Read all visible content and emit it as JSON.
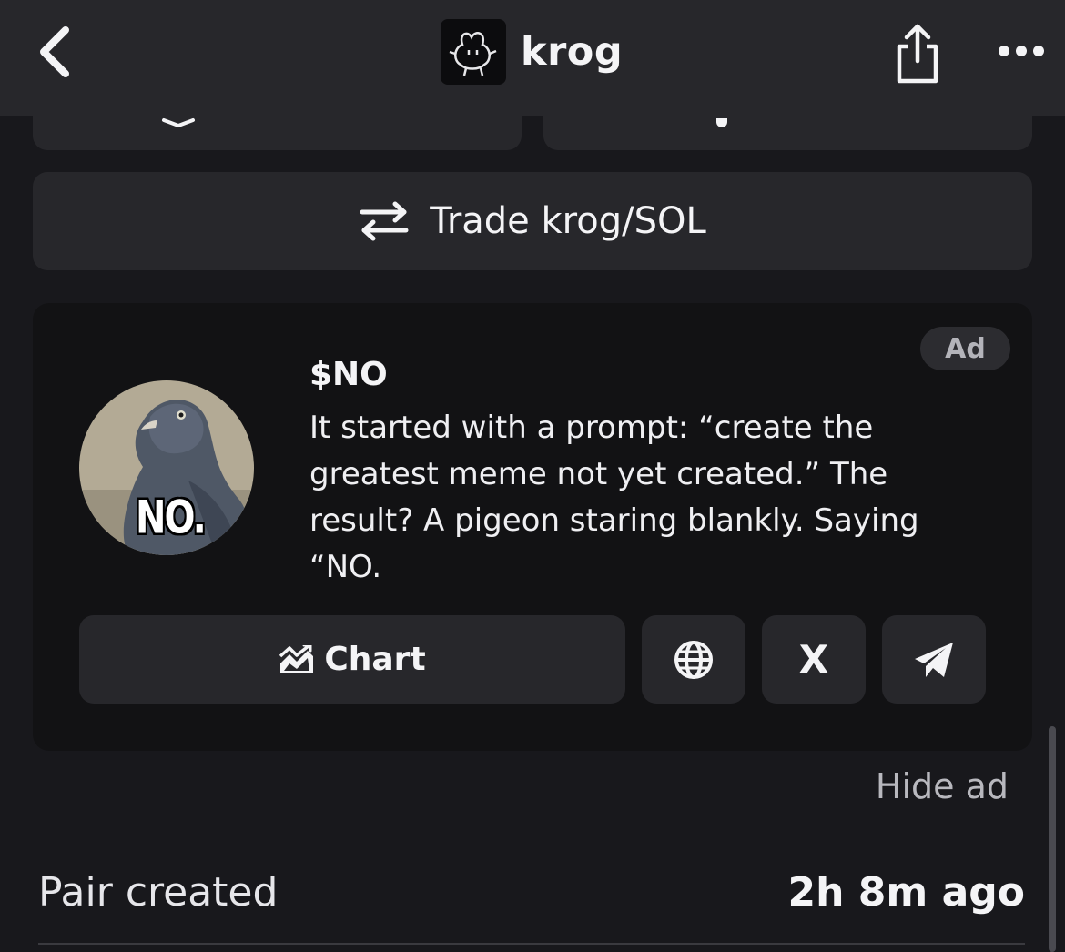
{
  "header": {
    "title": "krog",
    "back_icon": "chevron-left-icon",
    "share_icon": "share-icon",
    "more_icon": "more-icon"
  },
  "trade_button": {
    "label": "Trade krog/SOL",
    "icon": "swap-arrows-icon"
  },
  "ad": {
    "badge": "Ad",
    "token": "$NO",
    "description": "It started with a prompt: “create the greatest meme not yet created.”  The result? A pigeon staring blankly. Saying “NO.",
    "image_caption": "NO.",
    "chart_label": "Chart",
    "chart_icon": "chart-icon",
    "website_icon": "globe-icon",
    "x_label": "X",
    "telegram_icon": "telegram-icon"
  },
  "hide_ad": "Hide ad",
  "pair_info": {
    "label": "Pair created",
    "value": "2h 8m ago"
  },
  "colors": {
    "background": "#18181c",
    "surface": "#27272b",
    "card": "#121214"
  }
}
